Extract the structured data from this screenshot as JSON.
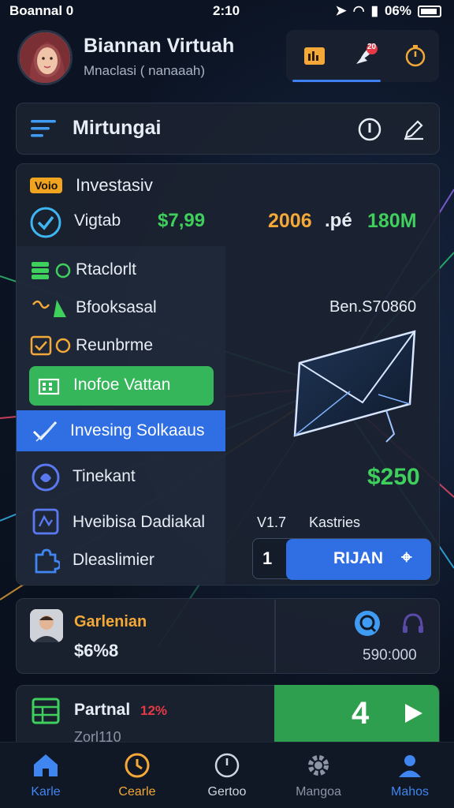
{
  "status_bar": {
    "carrier": "Boannal 0",
    "time": "2:10",
    "battery": "06%"
  },
  "header": {
    "user_name": "Biannan Virtuah",
    "user_subtitle": "Mnaclasi ( nanaaah)",
    "notification_count": "20"
  },
  "nav_bar": {
    "title": "Mirtungai"
  },
  "investments": {
    "badge": "Voio",
    "title": "Investasiv",
    "metric_label": "Vigtab",
    "metric_value": "$7,99",
    "summary_year": "2006",
    "summary_unit": ".pé",
    "summary_amount": "180M",
    "menu": [
      {
        "label": "Rtaclorlt"
      },
      {
        "label": "Bfooksasal"
      },
      {
        "label": "Reunbrme"
      }
    ],
    "primary_button": "Inofoe Vattan",
    "active_item": "Invesing Solkaaus",
    "menu_lower": [
      {
        "label": "Tinekant"
      },
      {
        "label": "Hveibisa Dadiakal"
      },
      {
        "label": "Dleaslimier"
      }
    ],
    "right_label": "Ben.S70860",
    "right_amount": "$250",
    "stat_left": "V1.7",
    "stat_right": "Kastries",
    "action_number": "1",
    "action_label": "RIJAN"
  },
  "profile_card": {
    "name": "Garlenian",
    "value": "$6%8",
    "right_value": "590:000"
  },
  "partial_card": {
    "name": "Partnal",
    "percent": "12%",
    "subtext": "Zorl110",
    "big_number": "4"
  },
  "bottom_nav": [
    {
      "label": "Karle",
      "color": "#3f86f0"
    },
    {
      "label": "Cearle",
      "color": "#f3a838"
    },
    {
      "label": "Gertoo",
      "color": "#d0d6e0"
    },
    {
      "label": "Mangoa",
      "color": "#8c95a6"
    },
    {
      "label": "Mahos",
      "color": "#3f86f0"
    }
  ]
}
